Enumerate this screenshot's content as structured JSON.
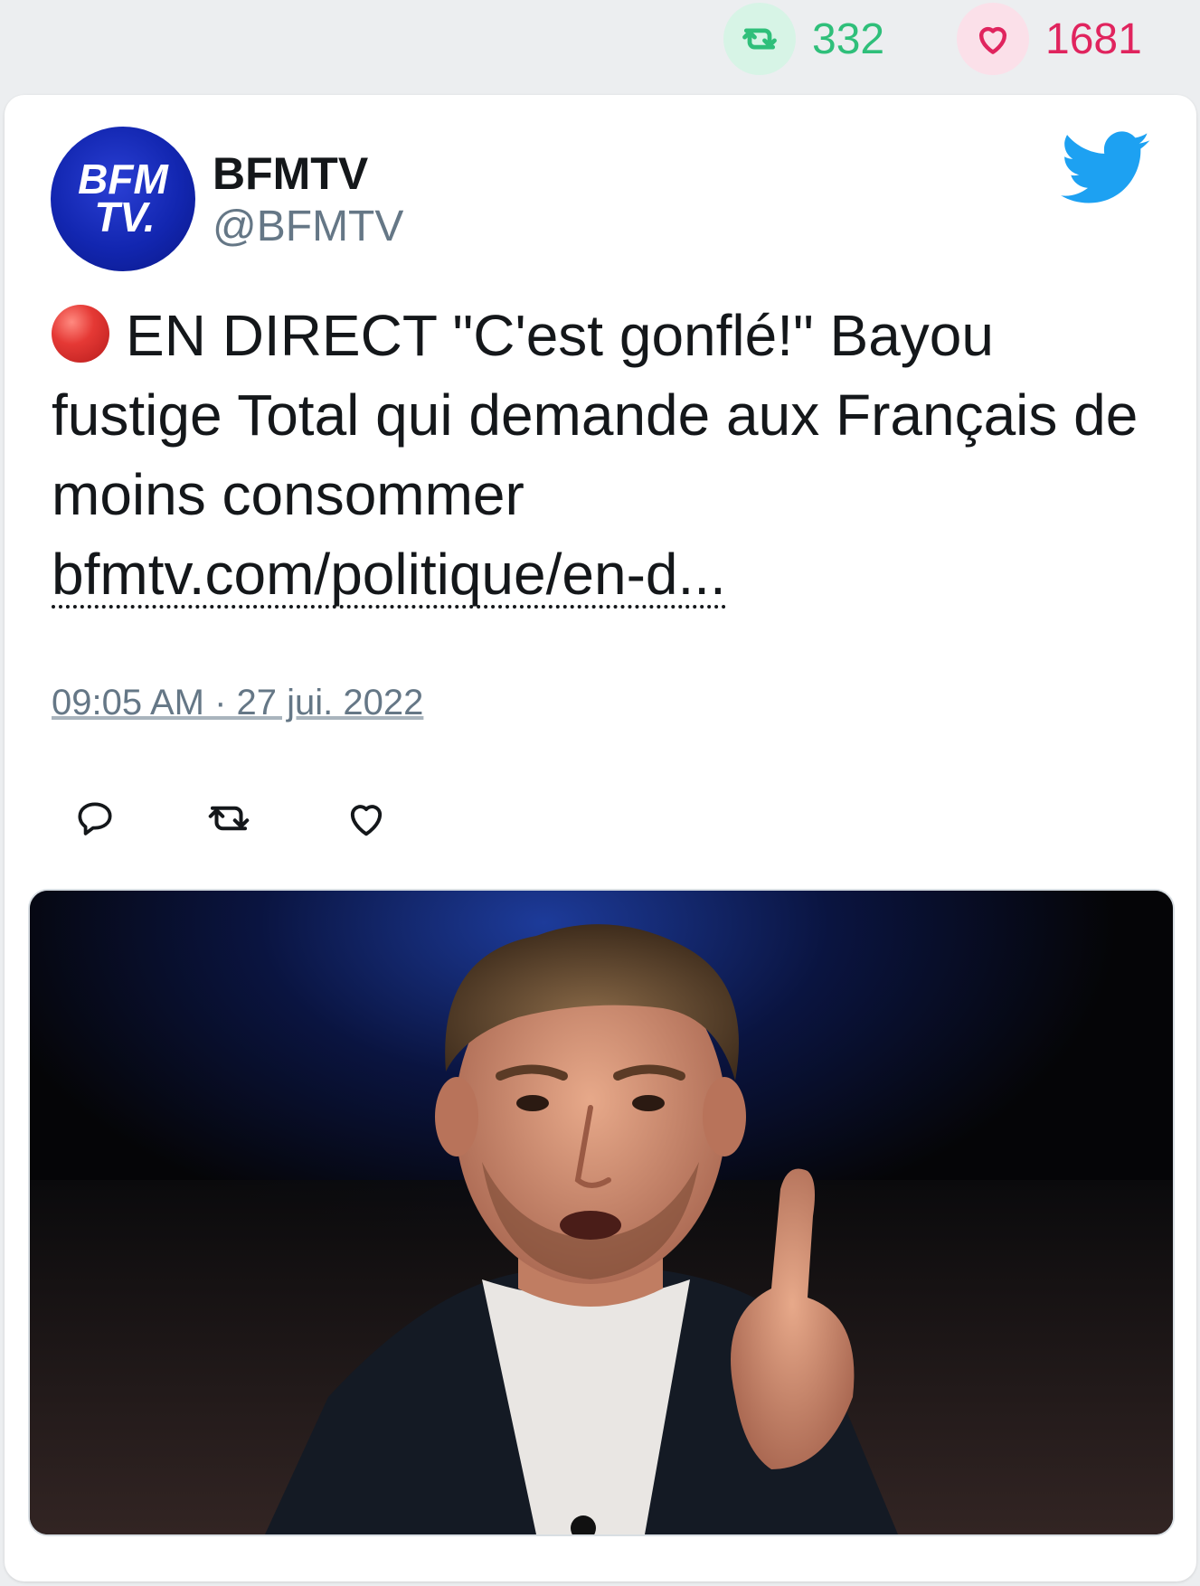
{
  "top_stats": {
    "retweets": "332",
    "likes": "1681",
    "retweet_color": "#2fbf7a",
    "like_color": "#e0245e"
  },
  "tweet": {
    "author": {
      "display_name": "BFMTV",
      "handle": "@BFMTV",
      "avatar_logo_line1": "BFM",
      "avatar_logo_line2": "TV."
    },
    "live_icon": "red-circle-icon",
    "text": "EN DIRECT \"C'est gonflé!\" Bayou fustige Total qui demande aux Français de moins consommer",
    "link": "bfmtv.com/politique/en-d...",
    "timestamp": "09:05 AM · 27 jui. 2022",
    "actions": [
      "reply-icon",
      "retweet-icon",
      "like-icon"
    ],
    "media": {
      "kind": "photo",
      "subject": "man-speaking-pointing-finger"
    },
    "brand_icon": "twitter-bird-icon",
    "accent_color": "#1da1f2"
  }
}
